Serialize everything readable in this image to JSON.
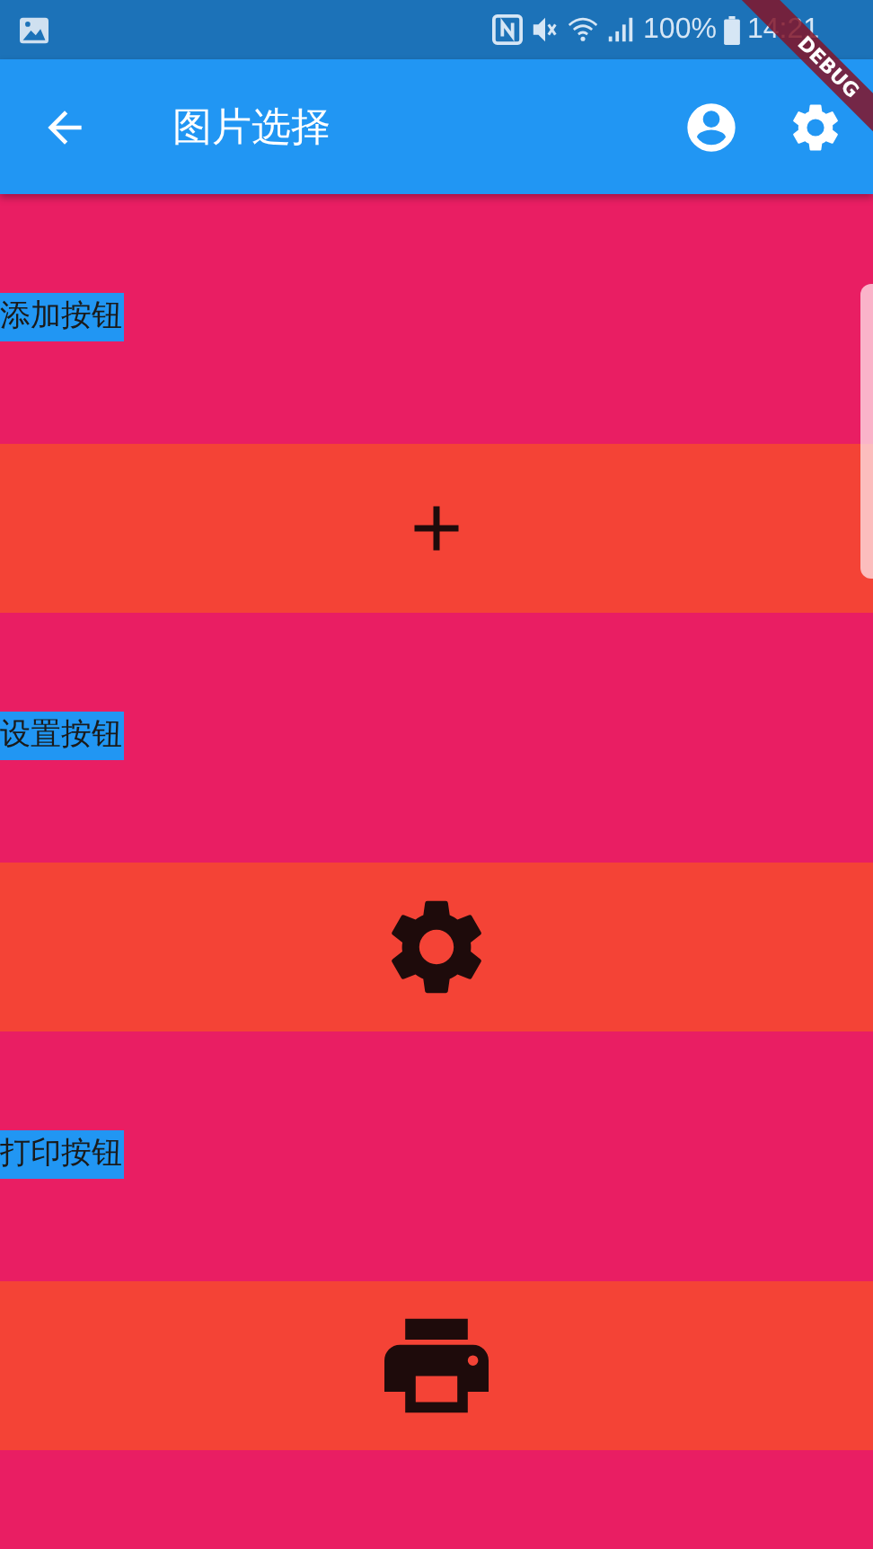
{
  "status_bar": {
    "battery": "100%",
    "time": "14:21"
  },
  "debug_banner": {
    "text": "DEBUG"
  },
  "app_bar": {
    "title": "图片选择"
  },
  "sections": [
    {
      "kind": "label",
      "text": "添加按钮"
    },
    {
      "kind": "plus"
    },
    {
      "kind": "label",
      "text": "设置按钮"
    },
    {
      "kind": "gear"
    },
    {
      "kind": "label",
      "text": "打印按钮"
    },
    {
      "kind": "printer"
    }
  ]
}
